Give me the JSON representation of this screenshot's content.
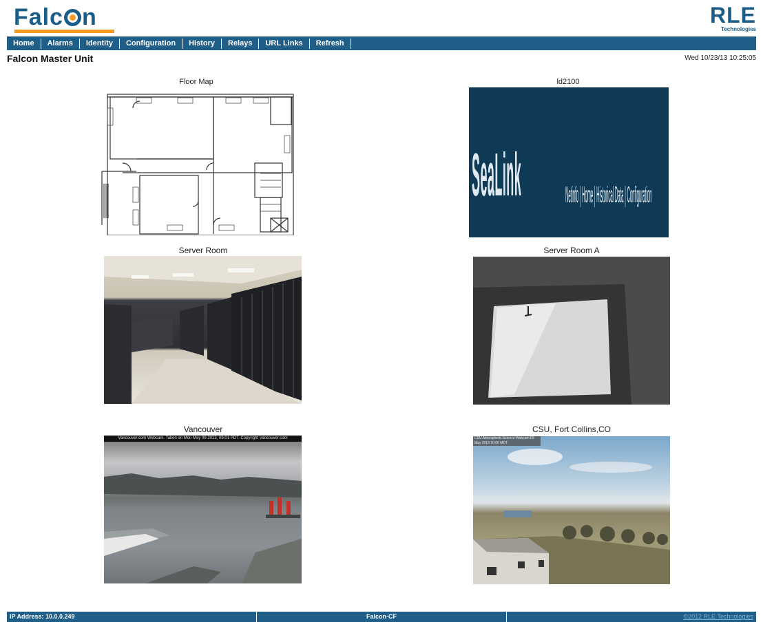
{
  "header": {
    "logo_text_a": "Falc",
    "logo_text_b": "n",
    "brand_main": "RLE",
    "brand_sub": "Technologies"
  },
  "nav": [
    "Home",
    "Alarms",
    "Identity",
    "Configuration",
    "History",
    "Relays",
    "URL Links",
    "Refresh"
  ],
  "page": {
    "title": "Falcon Master Unit",
    "datetime": "Wed 10/23/13 10:25:05"
  },
  "cameras": [
    {
      "label": "Floor Map"
    },
    {
      "label": "ld2100"
    },
    {
      "label": "Server Room"
    },
    {
      "label": "Server Room A"
    },
    {
      "label": "Vancouver"
    },
    {
      "label": "CSU, Fort Collins,CO"
    }
  ],
  "overlays": {
    "seallink_logo": "SeaLink",
    "seallink_menu": "Netinfo | Home | Historical Data | Configuration",
    "vancouver_banner": "Vancouver.com Webcam. Taken on Mon May 09 2013, 09:01 PDT. Copyright Vancouver.com",
    "csu_banner": "CSU Atmospheric Science Webcam 09 May 2013 10:00 MDT"
  },
  "footer": {
    "ip": "IP Address: 10.0.0.249",
    "device": "Falcon-CF",
    "copyright": "©2012 RLE Technologies"
  }
}
